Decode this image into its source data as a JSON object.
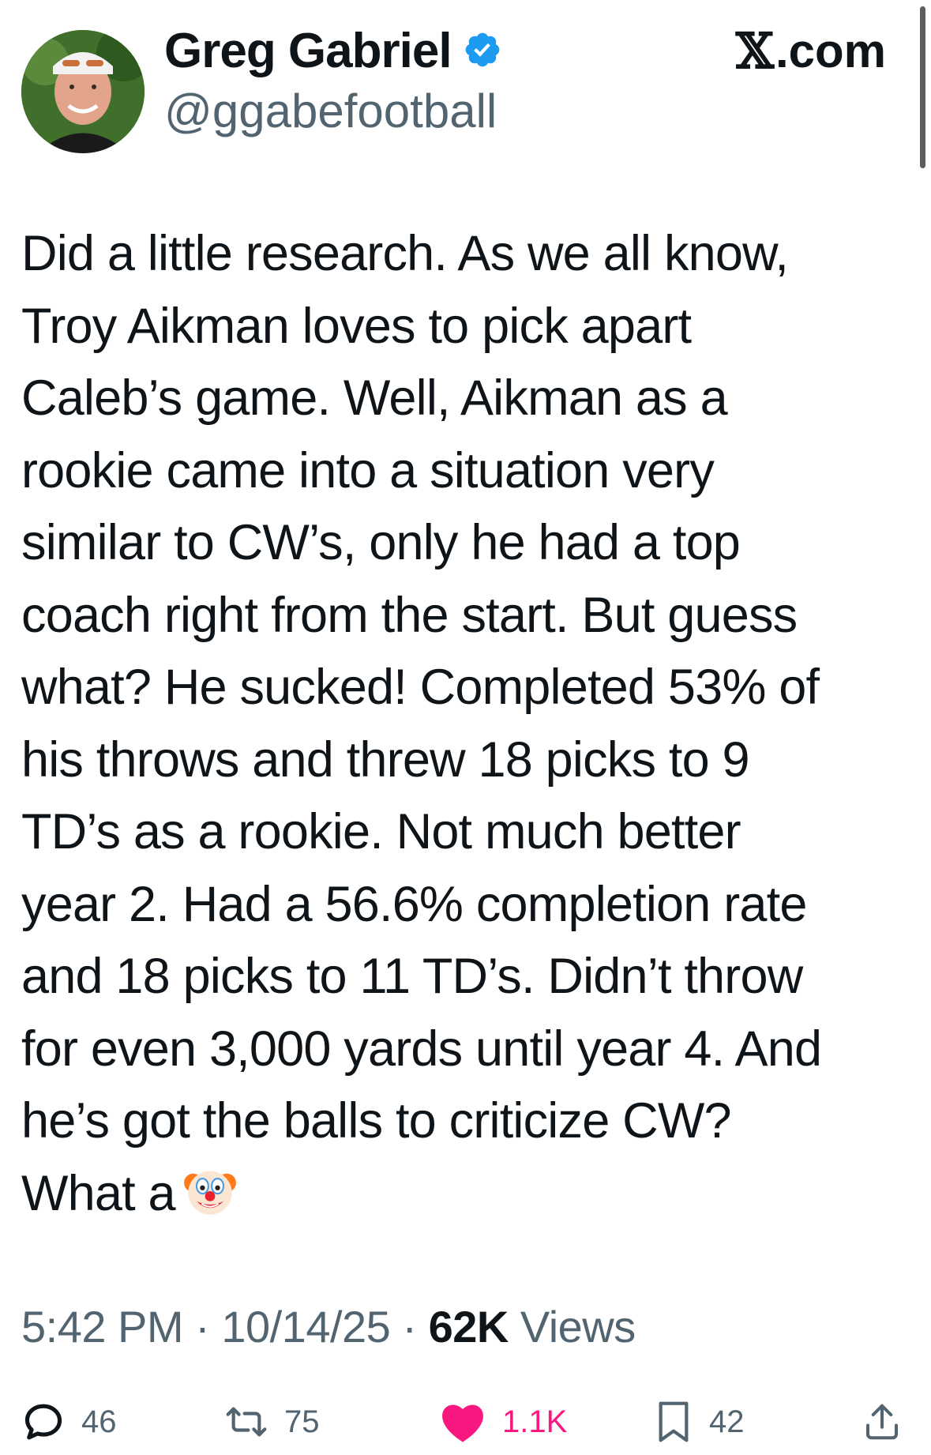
{
  "author": {
    "display_name": "Greg Gabriel",
    "handle": "@ggabefootball",
    "verified": true
  },
  "brand": {
    "logo_symbol": "𝕏",
    "logo_suffix": ".com"
  },
  "tweet": {
    "text": "Did a little research. As we all know,\nTroy Aikman loves to pick apart\nCaleb’s game. Well, Aikman as a\nrookie came into a situation very\nsimilar to CW’s, only he had a top\ncoach right from the start. But guess\nwhat? He sucked! Completed 53% of\nhis throws and threw 18 picks to 9\nTD’s as a rookie. Not much better\nyear 2. Had a 56.6% completion rate\nand 18 picks to 11 TD’s. Didn’t throw\nfor even 3,000 yards until year 4. And\nhe’s got the balls to criticize CW?\nWhat a",
    "trailing_emoji": "clown-face-emoji"
  },
  "meta": {
    "time": "5:42 PM",
    "separator": " · ",
    "date": "10/14/25",
    "views_count": "62K",
    "views_label": " Views"
  },
  "actions": {
    "replies": "46",
    "reposts": "75",
    "likes": "1.1K",
    "bookmarks": "42"
  },
  "colors": {
    "text": "#0f1419",
    "secondary": "#536471",
    "verified_blue": "#1d9bf0",
    "like_pink": "#f91880"
  },
  "icons": [
    "verified-icon",
    "reply-icon",
    "repost-icon",
    "like-icon",
    "bookmark-icon",
    "share-icon"
  ]
}
